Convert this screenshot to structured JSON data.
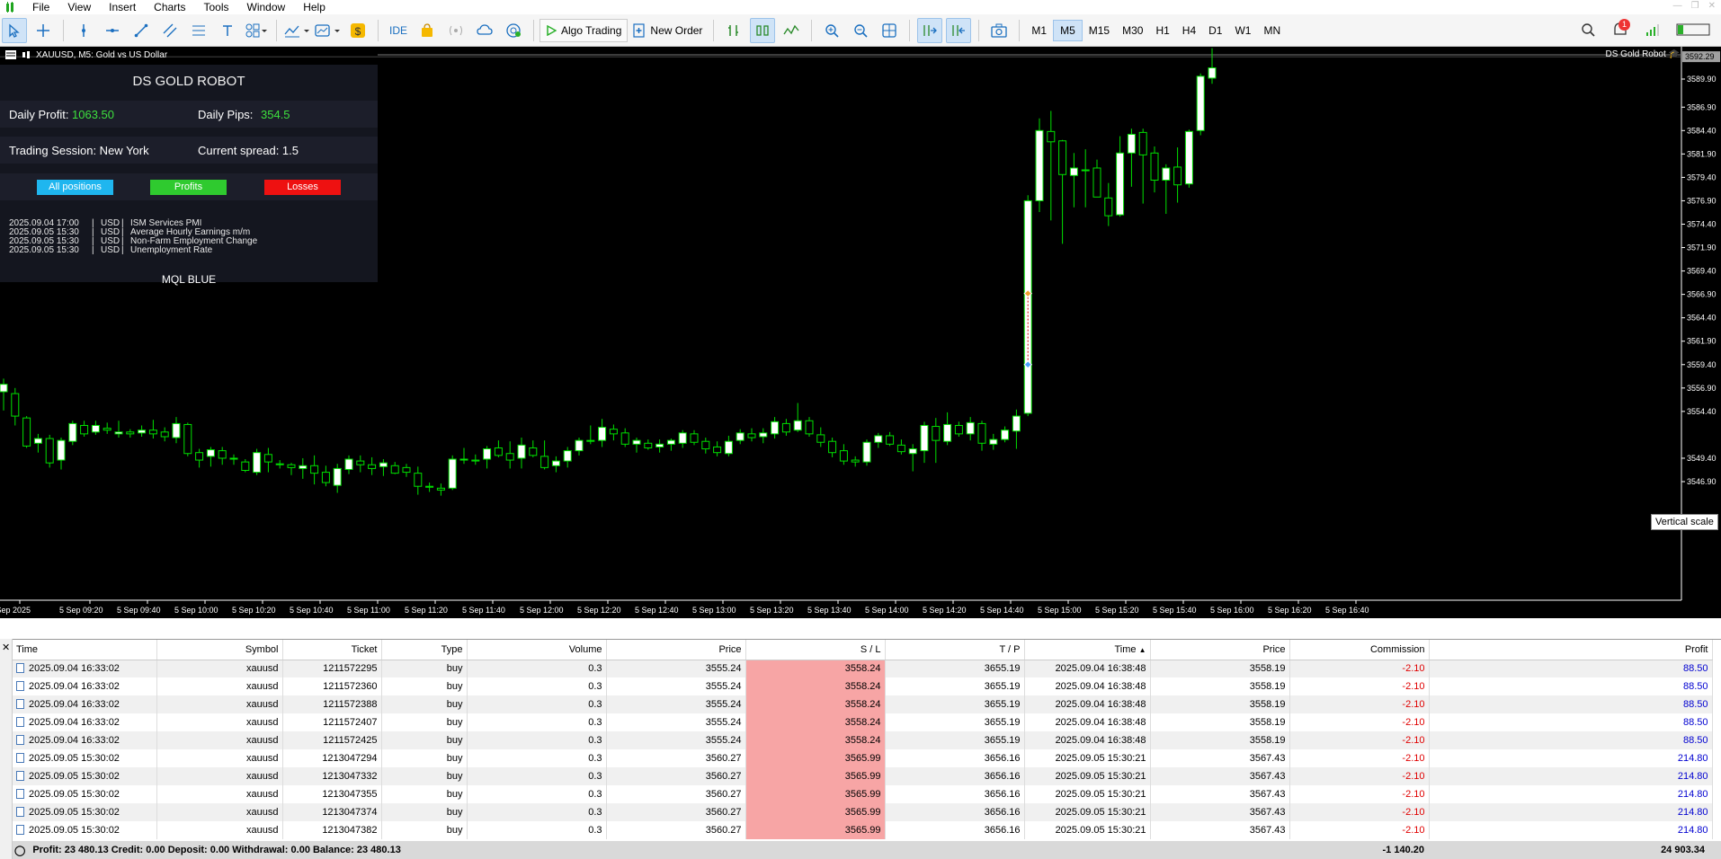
{
  "menu": [
    "File",
    "View",
    "Insert",
    "Charts",
    "Tools",
    "Window",
    "Help"
  ],
  "toolbar": {
    "ide": "IDE",
    "algo_trading": "Algo Trading",
    "new_order": "New Order",
    "timeframes": [
      "M1",
      "M5",
      "M15",
      "M30",
      "H1",
      "H4",
      "D1",
      "W1",
      "MN"
    ],
    "active_timeframe": "M5",
    "notification_count": "1"
  },
  "chart": {
    "symbol_title": "XAUUSD, M5:  Gold vs US Dollar",
    "robot_name": "DS Gold Robot",
    "current_price_label": "3592.29",
    "price_ticks": [
      "3589.90",
      "3586.90",
      "3584.40",
      "3581.90",
      "3579.40",
      "3576.90",
      "3574.40",
      "3571.90",
      "3569.40",
      "3566.90",
      "3564.40",
      "3561.90",
      "3559.40",
      "3556.90",
      "3554.40",
      "3549.40",
      "3546.90"
    ],
    "time_ticks": [
      "5 Sep 2025",
      "5 Sep 09:20",
      "5 Sep 09:40",
      "5 Sep 10:00",
      "5 Sep 10:20",
      "5 Sep 10:40",
      "5 Sep 11:00",
      "5 Sep 11:20",
      "5 Sep 11:40",
      "5 Sep 12:00",
      "5 Sep 12:20",
      "5 Sep 12:40",
      "5 Sep 13:00",
      "5 Sep 13:20",
      "5 Sep 13:40",
      "5 Sep 14:00",
      "5 Sep 14:20",
      "5 Sep 14:40",
      "5 Sep 15:00",
      "5 Sep 15:20",
      "5 Sep 15:40",
      "5 Sep 16:00",
      "5 Sep 16:20",
      "5 Sep 16:40"
    ],
    "vertical_scale_tip": "Vertical scale",
    "colors": {
      "bull": "#ffffff",
      "bear": "#000000",
      "wick": "#00e000",
      "background": "#000000"
    }
  },
  "chart_data": {
    "type": "candlestick",
    "ylim": [
      3545.0,
      3593.5
    ],
    "candles": [
      {
        "o": 3556.5,
        "h": 3557.9,
        "l": 3554.5,
        "c": 3557.3
      },
      {
        "o": 3556.3,
        "h": 3556.9,
        "l": 3552.9,
        "c": 3553.9
      },
      {
        "o": 3553.7,
        "h": 3553.9,
        "l": 3550.5,
        "c": 3550.7
      },
      {
        "o": 3551.0,
        "h": 3552.0,
        "l": 3550.0,
        "c": 3551.5
      },
      {
        "o": 3551.5,
        "h": 3551.9,
        "l": 3548.4,
        "c": 3548.9
      },
      {
        "o": 3549.2,
        "h": 3551.6,
        "l": 3548.2,
        "c": 3551.3
      },
      {
        "o": 3551.2,
        "h": 3553.4,
        "l": 3550.8,
        "c": 3553.1
      },
      {
        "o": 3552.9,
        "h": 3553.4,
        "l": 3551.7,
        "c": 3552.0
      },
      {
        "o": 3552.2,
        "h": 3553.4,
        "l": 3551.9,
        "c": 3552.9
      },
      {
        "o": 3552.6,
        "h": 3553.2,
        "l": 3552.0,
        "c": 3552.4
      },
      {
        "o": 3552.0,
        "h": 3553.4,
        "l": 3551.6,
        "c": 3552.2
      },
      {
        "o": 3552.2,
        "h": 3552.5,
        "l": 3551.6,
        "c": 3552.0
      },
      {
        "o": 3552.1,
        "h": 3552.9,
        "l": 3551.7,
        "c": 3552.4
      },
      {
        "o": 3552.4,
        "h": 3553.5,
        "l": 3551.5,
        "c": 3552.0
      },
      {
        "o": 3552.2,
        "h": 3552.7,
        "l": 3551.2,
        "c": 3551.7
      },
      {
        "o": 3551.6,
        "h": 3553.8,
        "l": 3551.0,
        "c": 3553.1
      },
      {
        "o": 3553.0,
        "h": 3553.2,
        "l": 3549.6,
        "c": 3549.9
      },
      {
        "o": 3550.0,
        "h": 3550.4,
        "l": 3548.4,
        "c": 3549.2
      },
      {
        "o": 3549.6,
        "h": 3550.6,
        "l": 3548.5,
        "c": 3550.3
      },
      {
        "o": 3550.2,
        "h": 3550.6,
        "l": 3548.7,
        "c": 3549.4
      },
      {
        "o": 3549.3,
        "h": 3549.8,
        "l": 3548.7,
        "c": 3549.4
      },
      {
        "o": 3549.0,
        "h": 3549.3,
        "l": 3547.9,
        "c": 3548.1
      },
      {
        "o": 3547.9,
        "h": 3550.4,
        "l": 3547.6,
        "c": 3550.0
      },
      {
        "o": 3549.8,
        "h": 3550.5,
        "l": 3547.9,
        "c": 3549.0
      },
      {
        "o": 3548.8,
        "h": 3549.2,
        "l": 3548.3,
        "c": 3548.8
      },
      {
        "o": 3548.7,
        "h": 3548.9,
        "l": 3547.6,
        "c": 3548.4
      },
      {
        "o": 3548.3,
        "h": 3549.4,
        "l": 3547.2,
        "c": 3548.6
      },
      {
        "o": 3548.6,
        "h": 3549.7,
        "l": 3546.6,
        "c": 3547.8
      },
      {
        "o": 3547.9,
        "h": 3548.6,
        "l": 3546.4,
        "c": 3546.8
      },
      {
        "o": 3546.5,
        "h": 3548.8,
        "l": 3545.7,
        "c": 3548.3
      },
      {
        "o": 3548.2,
        "h": 3549.7,
        "l": 3547.7,
        "c": 3549.3
      },
      {
        "o": 3549.1,
        "h": 3549.7,
        "l": 3547.9,
        "c": 3548.7
      },
      {
        "o": 3548.7,
        "h": 3549.5,
        "l": 3547.6,
        "c": 3548.3
      },
      {
        "o": 3548.5,
        "h": 3549.3,
        "l": 3547.5,
        "c": 3548.9
      },
      {
        "o": 3548.6,
        "h": 3549.0,
        "l": 3547.7,
        "c": 3547.8
      },
      {
        "o": 3548.4,
        "h": 3548.8,
        "l": 3547.4,
        "c": 3547.9
      },
      {
        "o": 3547.8,
        "h": 3548.5,
        "l": 3545.5,
        "c": 3546.4
      },
      {
        "o": 3546.4,
        "h": 3546.8,
        "l": 3545.8,
        "c": 3546.3
      },
      {
        "o": 3546.2,
        "h": 3546.7,
        "l": 3545.4,
        "c": 3546.0
      },
      {
        "o": 3546.2,
        "h": 3549.7,
        "l": 3546.0,
        "c": 3549.3
      },
      {
        "o": 3549.2,
        "h": 3550.5,
        "l": 3548.8,
        "c": 3549.3
      },
      {
        "o": 3549.2,
        "h": 3549.8,
        "l": 3548.7,
        "c": 3549.1
      },
      {
        "o": 3549.3,
        "h": 3550.7,
        "l": 3548.3,
        "c": 3550.4
      },
      {
        "o": 3550.5,
        "h": 3551.3,
        "l": 3549.5,
        "c": 3549.7
      },
      {
        "o": 3549.9,
        "h": 3551.2,
        "l": 3548.3,
        "c": 3549.2
      },
      {
        "o": 3549.4,
        "h": 3551.6,
        "l": 3548.3,
        "c": 3550.8
      },
      {
        "o": 3550.5,
        "h": 3551.3,
        "l": 3549.5,
        "c": 3549.7
      },
      {
        "o": 3549.6,
        "h": 3551.3,
        "l": 3548.2,
        "c": 3548.4
      },
      {
        "o": 3548.6,
        "h": 3549.6,
        "l": 3547.9,
        "c": 3549.1
      },
      {
        "o": 3549.1,
        "h": 3550.6,
        "l": 3548.4,
        "c": 3550.2
      },
      {
        "o": 3550.2,
        "h": 3551.6,
        "l": 3549.7,
        "c": 3551.3
      },
      {
        "o": 3551.3,
        "h": 3552.9,
        "l": 3550.9,
        "c": 3551.3
      },
      {
        "o": 3551.3,
        "h": 3553.6,
        "l": 3550.6,
        "c": 3552.7
      },
      {
        "o": 3552.5,
        "h": 3553.0,
        "l": 3551.3,
        "c": 3552.0
      },
      {
        "o": 3552.1,
        "h": 3552.6,
        "l": 3550.6,
        "c": 3550.9
      },
      {
        "o": 3550.9,
        "h": 3551.6,
        "l": 3550.0,
        "c": 3551.3
      },
      {
        "o": 3551.0,
        "h": 3551.4,
        "l": 3550.3,
        "c": 3550.5
      },
      {
        "o": 3550.6,
        "h": 3551.4,
        "l": 3550.0,
        "c": 3550.9
      },
      {
        "o": 3550.9,
        "h": 3551.5,
        "l": 3550.2,
        "c": 3551.3
      },
      {
        "o": 3551.0,
        "h": 3552.4,
        "l": 3550.5,
        "c": 3552.1
      },
      {
        "o": 3552.0,
        "h": 3552.4,
        "l": 3550.8,
        "c": 3551.1
      },
      {
        "o": 3551.2,
        "h": 3551.6,
        "l": 3549.9,
        "c": 3550.4
      },
      {
        "o": 3550.6,
        "h": 3551.2,
        "l": 3549.6,
        "c": 3550.0
      },
      {
        "o": 3549.9,
        "h": 3551.8,
        "l": 3549.6,
        "c": 3551.2
      },
      {
        "o": 3551.3,
        "h": 3552.5,
        "l": 3550.9,
        "c": 3552.1
      },
      {
        "o": 3552.0,
        "h": 3552.6,
        "l": 3551.2,
        "c": 3551.6
      },
      {
        "o": 3551.7,
        "h": 3552.6,
        "l": 3551.0,
        "c": 3552.1
      },
      {
        "o": 3552.0,
        "h": 3553.8,
        "l": 3551.5,
        "c": 3553.3
      },
      {
        "o": 3553.1,
        "h": 3553.6,
        "l": 3551.8,
        "c": 3552.2
      },
      {
        "o": 3552.4,
        "h": 3555.3,
        "l": 3552.2,
        "c": 3553.4
      },
      {
        "o": 3553.4,
        "h": 3553.8,
        "l": 3551.7,
        "c": 3552.0
      },
      {
        "o": 3551.9,
        "h": 3552.7,
        "l": 3550.6,
        "c": 3551.1
      },
      {
        "o": 3551.2,
        "h": 3551.6,
        "l": 3549.5,
        "c": 3550.0
      },
      {
        "o": 3550.2,
        "h": 3550.9,
        "l": 3548.7,
        "c": 3549.1
      },
      {
        "o": 3549.2,
        "h": 3549.6,
        "l": 3548.5,
        "c": 3549.0
      },
      {
        "o": 3549.0,
        "h": 3551.4,
        "l": 3548.6,
        "c": 3551.1
      },
      {
        "o": 3551.1,
        "h": 3552.1,
        "l": 3550.5,
        "c": 3551.8
      },
      {
        "o": 3551.8,
        "h": 3552.2,
        "l": 3550.7,
        "c": 3550.9
      },
      {
        "o": 3550.8,
        "h": 3551.4,
        "l": 3549.8,
        "c": 3550.1
      },
      {
        "o": 3549.9,
        "h": 3550.9,
        "l": 3548.0,
        "c": 3550.4
      },
      {
        "o": 3550.2,
        "h": 3553.3,
        "l": 3548.9,
        "c": 3552.9
      },
      {
        "o": 3552.8,
        "h": 3553.7,
        "l": 3548.9,
        "c": 3551.3
      },
      {
        "o": 3551.2,
        "h": 3554.3,
        "l": 3550.8,
        "c": 3553.0
      },
      {
        "o": 3552.9,
        "h": 3553.3,
        "l": 3551.7,
        "c": 3552.0
      },
      {
        "o": 3552.0,
        "h": 3553.8,
        "l": 3551.3,
        "c": 3553.2
      },
      {
        "o": 3553.1,
        "h": 3553.4,
        "l": 3550.2,
        "c": 3551.0
      },
      {
        "o": 3550.9,
        "h": 3552.0,
        "l": 3550.3,
        "c": 3551.4
      },
      {
        "o": 3551.4,
        "h": 3552.8,
        "l": 3551.1,
        "c": 3552.4
      },
      {
        "o": 3552.3,
        "h": 3554.6,
        "l": 3550.4,
        "c": 3553.9
      },
      {
        "o": 3554.2,
        "h": 3577.5,
        "l": 3553.9,
        "c": 3576.9
      },
      {
        "o": 3576.9,
        "h": 3585.7,
        "l": 3575.7,
        "c": 3584.4
      },
      {
        "o": 3584.3,
        "h": 3586.5,
        "l": 3574.8,
        "c": 3583.2
      },
      {
        "o": 3583.3,
        "h": 3583.4,
        "l": 3572.3,
        "c": 3579.7
      },
      {
        "o": 3579.6,
        "h": 3582.0,
        "l": 3576.2,
        "c": 3580.4
      },
      {
        "o": 3580.2,
        "h": 3582.4,
        "l": 3576.2,
        "c": 3580.2
      },
      {
        "o": 3580.4,
        "h": 3581.3,
        "l": 3577.8,
        "c": 3577.3
      },
      {
        "o": 3577.2,
        "h": 3578.8,
        "l": 3574.2,
        "c": 3575.3
      },
      {
        "o": 3575.4,
        "h": 3583.8,
        "l": 3575.2,
        "c": 3582.0
      },
      {
        "o": 3582.0,
        "h": 3584.6,
        "l": 3578.4,
        "c": 3584.0
      },
      {
        "o": 3584.2,
        "h": 3584.6,
        "l": 3576.6,
        "c": 3581.8
      },
      {
        "o": 3582.0,
        "h": 3582.7,
        "l": 3577.8,
        "c": 3579.1
      },
      {
        "o": 3579.1,
        "h": 3580.8,
        "l": 3575.5,
        "c": 3580.4
      },
      {
        "o": 3580.5,
        "h": 3582.6,
        "l": 3576.7,
        "c": 3578.6
      },
      {
        "o": 3578.7,
        "h": 3584.5,
        "l": 3578.3,
        "c": 3584.3
      },
      {
        "o": 3584.4,
        "h": 3590.5,
        "l": 3583.9,
        "c": 3590.2
      },
      {
        "o": 3590.0,
        "h": 3593.2,
        "l": 3589.4,
        "c": 3591.1
      }
    ],
    "trade_markers": [
      {
        "price": 3567.0
      },
      {
        "price": 3559.4
      }
    ]
  },
  "panel": {
    "title": "DS GOLD ROBOT",
    "daily_profit_label": "Daily Profit:",
    "daily_profit_value": "1063.50",
    "daily_pips_label": "Daily Pips:",
    "daily_pips_value": "354.5",
    "session_label": "Trading Session: New York",
    "spread_label": "Current spread: 1.5",
    "btn_all": "All positions",
    "btn_profits": "Profits",
    "btn_losses": "Losses",
    "news": [
      {
        "time": "2025.09.04 17:00",
        "cur": "USD",
        "event": "ISM Services PMI"
      },
      {
        "time": "2025.09.05 15:30",
        "cur": "USD",
        "event": "Average Hourly Earnings m/m"
      },
      {
        "time": "2025.09.05 15:30",
        "cur": "USD",
        "event": "Non-Farm Employment Change"
      },
      {
        "time": "2025.09.05 15:30",
        "cur": "USD",
        "event": "Unemployment Rate"
      }
    ],
    "footer": "MQL BLUE",
    "colors": {
      "btn_all": "#1fb6ef",
      "btn_profits": "#2fca2f",
      "btn_losses": "#ee1111"
    }
  },
  "trades": {
    "columns": [
      "Time",
      "Symbol",
      "Ticket",
      "Type",
      "Volume",
      "Price",
      "S / L",
      "T / P",
      "Time",
      "Price",
      "Commission",
      "Profit"
    ],
    "rows": [
      [
        "2025.09.04 16:33:02",
        "xauusd",
        "1211572295",
        "buy",
        "0.3",
        "3555.24",
        "3558.24",
        "3655.19",
        "2025.09.04 16:38:48",
        "3558.19",
        "-2.10",
        "88.50"
      ],
      [
        "2025.09.04 16:33:02",
        "xauusd",
        "1211572360",
        "buy",
        "0.3",
        "3555.24",
        "3558.24",
        "3655.19",
        "2025.09.04 16:38:48",
        "3558.19",
        "-2.10",
        "88.50"
      ],
      [
        "2025.09.04 16:33:02",
        "xauusd",
        "1211572388",
        "buy",
        "0.3",
        "3555.24",
        "3558.24",
        "3655.19",
        "2025.09.04 16:38:48",
        "3558.19",
        "-2.10",
        "88.50"
      ],
      [
        "2025.09.04 16:33:02",
        "xauusd",
        "1211572407",
        "buy",
        "0.3",
        "3555.24",
        "3558.24",
        "3655.19",
        "2025.09.04 16:38:48",
        "3558.19",
        "-2.10",
        "88.50"
      ],
      [
        "2025.09.04 16:33:02",
        "xauusd",
        "1211572425",
        "buy",
        "0.3",
        "3555.24",
        "3558.24",
        "3655.19",
        "2025.09.04 16:38:48",
        "3558.19",
        "-2.10",
        "88.50"
      ],
      [
        "2025.09.05 15:30:02",
        "xauusd",
        "1213047294",
        "buy",
        "0.3",
        "3560.27",
        "3565.99",
        "3656.16",
        "2025.09.05 15:30:21",
        "3567.43",
        "-2.10",
        "214.80"
      ],
      [
        "2025.09.05 15:30:02",
        "xauusd",
        "1213047332",
        "buy",
        "0.3",
        "3560.27",
        "3565.99",
        "3656.16",
        "2025.09.05 15:30:21",
        "3567.43",
        "-2.10",
        "214.80"
      ],
      [
        "2025.09.05 15:30:02",
        "xauusd",
        "1213047355",
        "buy",
        "0.3",
        "3560.27",
        "3565.99",
        "3656.16",
        "2025.09.05 15:30:21",
        "3567.43",
        "-2.10",
        "214.80"
      ],
      [
        "2025.09.05 15:30:02",
        "xauusd",
        "1213047374",
        "buy",
        "0.3",
        "3560.27",
        "3565.99",
        "3656.16",
        "2025.09.05 15:30:21",
        "3567.43",
        "-2.10",
        "214.80"
      ],
      [
        "2025.09.05 15:30:02",
        "xauusd",
        "1213047382",
        "buy",
        "0.3",
        "3560.27",
        "3565.99",
        "3656.16",
        "2025.09.05 15:30:21",
        "3567.43",
        "-2.10",
        "214.80"
      ]
    ],
    "summary": "Profit: 23 480.13  Credit: 0.00  Deposit: 0.00  Withdrawal: 0.00  Balance: 23 480.13",
    "total_commission": "-1 140.20",
    "total_profit": "24 903.34"
  }
}
